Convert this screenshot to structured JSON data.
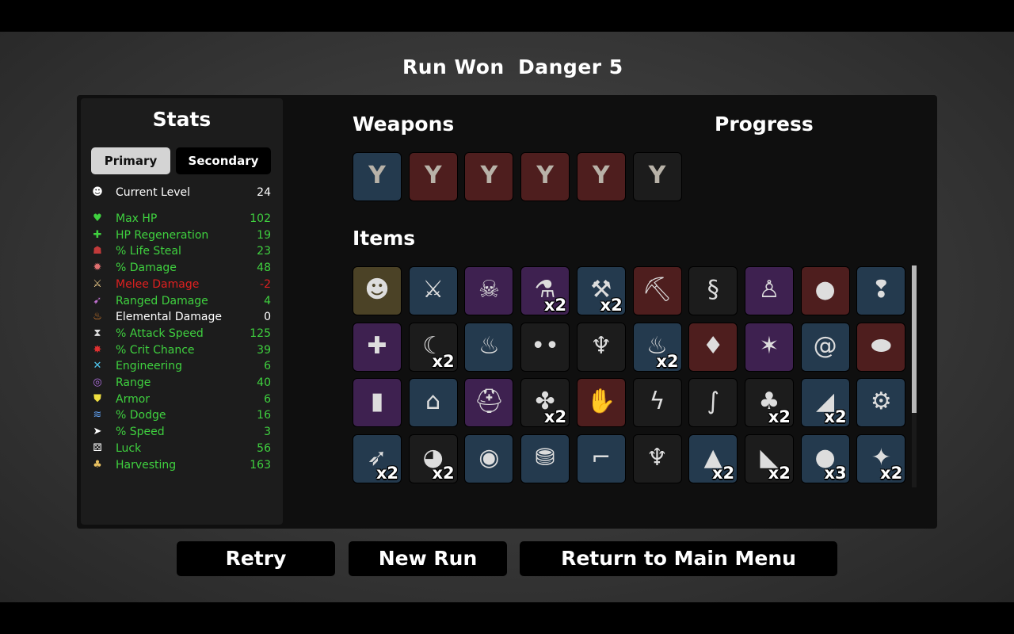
{
  "header": {
    "result": "Run Won",
    "danger": "Danger 5"
  },
  "stats": {
    "title": "Stats",
    "tabs": {
      "primary": "Primary",
      "secondary": "Secondary"
    },
    "level": {
      "label": "Current Level",
      "value": "24"
    },
    "rows": [
      {
        "icon": "heart-icon",
        "glyph": "♥",
        "iconColor": "#3fd13f",
        "label": "Max HP",
        "value": "102",
        "color": "#3fd13f"
      },
      {
        "icon": "hp-regen-icon",
        "glyph": "✚",
        "iconColor": "#3fd13f",
        "label": "HP Regeneration",
        "value": "19",
        "color": "#3fd13f"
      },
      {
        "icon": "life-steal-icon",
        "glyph": "☗",
        "iconColor": "#c23a3a",
        "label": "% Life Steal",
        "value": "23",
        "color": "#3fd13f"
      },
      {
        "icon": "damage-icon",
        "glyph": "✹",
        "iconColor": "#e07070",
        "label": "% Damage",
        "value": "48",
        "color": "#3fd13f"
      },
      {
        "icon": "melee-damage-icon",
        "glyph": "⚔",
        "iconColor": "#e8c888",
        "label": "Melee Damage",
        "value": "-2",
        "color": "#e02020"
      },
      {
        "icon": "ranged-damage-icon",
        "glyph": "➹",
        "iconColor": "#c070d0",
        "label": "Ranged Damage",
        "value": "4",
        "color": "#3fd13f"
      },
      {
        "icon": "elemental-damage-icon",
        "glyph": "♨",
        "iconColor": "#f08a30",
        "label": "Elemental Damage",
        "value": "0",
        "color": "#ffffff"
      },
      {
        "icon": "attack-speed-icon",
        "glyph": "⧗",
        "iconColor": "#dddddd",
        "label": "% Attack Speed",
        "value": "125",
        "color": "#3fd13f"
      },
      {
        "icon": "crit-chance-icon",
        "glyph": "✸",
        "iconColor": "#e03030",
        "label": "% Crit Chance",
        "value": "39",
        "color": "#3fd13f"
      },
      {
        "icon": "engineering-icon",
        "glyph": "✕",
        "iconColor": "#50c8f0",
        "label": "Engineering",
        "value": "6",
        "color": "#3fd13f"
      },
      {
        "icon": "range-icon",
        "glyph": "◎",
        "iconColor": "#b070e0",
        "label": "Range",
        "value": "40",
        "color": "#3fd13f"
      },
      {
        "icon": "armor-icon",
        "glyph": "⛊",
        "iconColor": "#f0e040",
        "label": "Armor",
        "value": "6",
        "color": "#3fd13f"
      },
      {
        "icon": "dodge-icon",
        "glyph": "≋",
        "iconColor": "#60a0f0",
        "label": "% Dodge",
        "value": "16",
        "color": "#3fd13f"
      },
      {
        "icon": "speed-icon",
        "glyph": "➤",
        "iconColor": "#ffffff",
        "label": "% Speed",
        "value": "3",
        "color": "#3fd13f"
      },
      {
        "icon": "luck-icon",
        "glyph": "⚄",
        "iconColor": "#ffffff",
        "label": "Luck",
        "value": "56",
        "color": "#3fd13f"
      },
      {
        "icon": "harvesting-icon",
        "glyph": "♣",
        "iconColor": "#e8c060",
        "label": "Harvesting",
        "value": "163",
        "color": "#3fd13f"
      }
    ]
  },
  "sections": {
    "weapons": "Weapons",
    "progress": "Progress",
    "items": "Items"
  },
  "weapons": [
    {
      "tier": "blue"
    },
    {
      "tier": "red"
    },
    {
      "tier": "red"
    },
    {
      "tier": "red"
    },
    {
      "tier": "red"
    },
    {
      "tier": "gray"
    }
  ],
  "weapon_icon": "slingshot-icon",
  "tier_colors": {
    "gray": "#1c1c1c",
    "blue": "#243a4e",
    "purple": "#3e2150",
    "red": "#4e1e1e",
    "gold": "#4b4226"
  },
  "items": [
    {
      "icon": "mask-icon",
      "glyph": "☻",
      "tier": "gold",
      "count": ""
    },
    {
      "icon": "sword-cross-icon",
      "glyph": "⚔",
      "tier": "blue",
      "count": ""
    },
    {
      "icon": "skull-pile-icon",
      "glyph": "☠",
      "tier": "purple",
      "count": ""
    },
    {
      "icon": "potion-bottle-icon",
      "glyph": "⚗",
      "tier": "purple",
      "count": "x2"
    },
    {
      "icon": "dumbbell-icon",
      "glyph": "⚒",
      "tier": "blue",
      "count": "x2"
    },
    {
      "icon": "anvil-icon",
      "glyph": "⛏",
      "tier": "red",
      "count": ""
    },
    {
      "icon": "snake-icon",
      "glyph": "§",
      "tier": "gray",
      "count": ""
    },
    {
      "icon": "statue-icon",
      "glyph": "♙",
      "tier": "purple",
      "count": ""
    },
    {
      "icon": "red-blob-icon",
      "glyph": "●",
      "tier": "red",
      "count": ""
    },
    {
      "icon": "alien-helmet-icon",
      "glyph": "❢",
      "tier": "blue",
      "count": ""
    },
    {
      "icon": "blood-bag-icon",
      "glyph": "✚",
      "tier": "purple",
      "count": ""
    },
    {
      "icon": "fang-icon",
      "glyph": "☾",
      "tier": "gray",
      "count": "x2"
    },
    {
      "icon": "campfire-icon",
      "glyph": "♨",
      "tier": "blue",
      "count": ""
    },
    {
      "icon": "eyes-icon",
      "glyph": "••",
      "tier": "gray",
      "count": ""
    },
    {
      "icon": "cauldron-icon",
      "glyph": "♆",
      "tier": "gray",
      "count": ""
    },
    {
      "icon": "horn-icon",
      "glyph": "♨",
      "tier": "blue",
      "count": "x2"
    },
    {
      "icon": "ribs-icon",
      "glyph": "♦",
      "tier": "red",
      "count": ""
    },
    {
      "icon": "pink-blob-icon",
      "glyph": "✶",
      "tier": "purple",
      "count": ""
    },
    {
      "icon": "snail-icon",
      "glyph": "@",
      "tier": "blue",
      "count": ""
    },
    {
      "icon": "potato-icon",
      "glyph": "⬬",
      "tier": "red",
      "count": ""
    },
    {
      "icon": "bullet-icon",
      "glyph": "▮",
      "tier": "purple",
      "count": ""
    },
    {
      "icon": "ruins-icon",
      "glyph": "⌂",
      "tier": "blue",
      "count": ""
    },
    {
      "icon": "knight-helmet-icon",
      "glyph": "⛑",
      "tier": "purple",
      "count": ""
    },
    {
      "icon": "fly-icon",
      "glyph": "✤",
      "tier": "gray",
      "count": "x2"
    },
    {
      "icon": "hand-bone-icon",
      "glyph": "✋",
      "tier": "red",
      "count": ""
    },
    {
      "icon": "green-snake-icon",
      "glyph": "ϟ",
      "tier": "gray",
      "count": ""
    },
    {
      "icon": "red-tentacle-icon",
      "glyph": "∫",
      "tier": "gray",
      "count": ""
    },
    {
      "icon": "tree-icon",
      "glyph": "♣",
      "tier": "gray",
      "count": "x2"
    },
    {
      "icon": "claw-blade-icon",
      "glyph": "◢",
      "tier": "blue",
      "count": "x2"
    },
    {
      "icon": "machine-icon",
      "glyph": "⚙",
      "tier": "blue",
      "count": ""
    },
    {
      "icon": "missile-icon",
      "glyph": "➶",
      "tier": "blue",
      "count": "x2"
    },
    {
      "icon": "duck-icon",
      "glyph": "◕",
      "tier": "gray",
      "count": "x2"
    },
    {
      "icon": "red-target-icon",
      "glyph": "◉",
      "tier": "blue",
      "count": ""
    },
    {
      "icon": "bucket-icon",
      "glyph": "⛃",
      "tier": "blue",
      "count": ""
    },
    {
      "icon": "robot-arm-icon",
      "glyph": "⌐",
      "tier": "blue",
      "count": ""
    },
    {
      "icon": "flamingo-icon",
      "glyph": "♆",
      "tier": "gray",
      "count": ""
    },
    {
      "icon": "shell-icon",
      "glyph": "▲",
      "tier": "blue",
      "count": "x2"
    },
    {
      "icon": "cake-icon",
      "glyph": "◣",
      "tier": "gray",
      "count": "x2"
    },
    {
      "icon": "black-blobs-icon",
      "glyph": "●",
      "tier": "blue",
      "count": "x3"
    },
    {
      "icon": "red-scarf-icon",
      "glyph": "✦",
      "tier": "blue",
      "count": "x2"
    }
  ],
  "buttons": {
    "retry": "Retry",
    "new_run": "New Run",
    "main_menu": "Return to Main Menu"
  }
}
